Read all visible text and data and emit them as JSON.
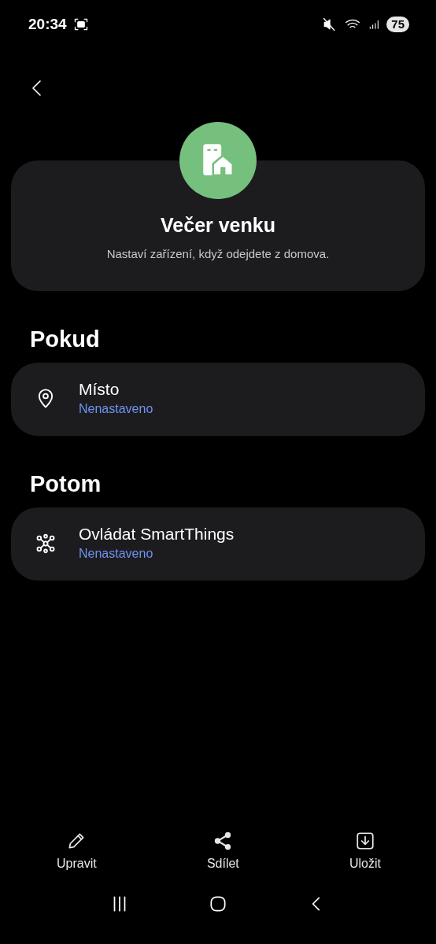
{
  "status_bar": {
    "time": "20:34",
    "battery": "75"
  },
  "header": {
    "title": "Večer venku",
    "description": "Nastaví zařízení, když odejdete z domova."
  },
  "sections": [
    {
      "heading": "Pokud",
      "items": [
        {
          "kind": "location",
          "title": "Místo",
          "value": "Nenastaveno"
        }
      ]
    },
    {
      "heading": "Potom",
      "items": [
        {
          "kind": "hub",
          "title": "Ovládat SmartThings",
          "value": "Nenastaveno"
        }
      ]
    }
  ],
  "actions": [
    {
      "kind": "edit",
      "label": "Upravit"
    },
    {
      "kind": "share",
      "label": "Sdílet"
    },
    {
      "kind": "save",
      "label": "Uložit"
    }
  ]
}
